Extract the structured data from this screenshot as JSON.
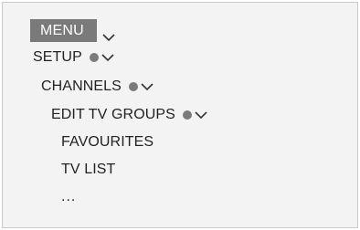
{
  "menu": {
    "button_label": "MENU",
    "items": [
      {
        "label": "SETUP",
        "has_dot": true,
        "has_chevron": true
      },
      {
        "label": "CHANNELS",
        "has_dot": true,
        "has_chevron": true
      },
      {
        "label": "EDIT TV GROUPS",
        "has_dot": true,
        "has_chevron": true
      },
      {
        "label": "FAVOURITES"
      },
      {
        "label": "TV LIST"
      },
      {
        "label": "..."
      }
    ]
  },
  "colors": {
    "panel_bg": "#f3f3f3",
    "button_bg": "#7a7a7a",
    "dot": "#7a7a7a",
    "text": "#222222"
  },
  "icons": [
    "chevron-down-icon",
    "selection-dot-icon"
  ]
}
